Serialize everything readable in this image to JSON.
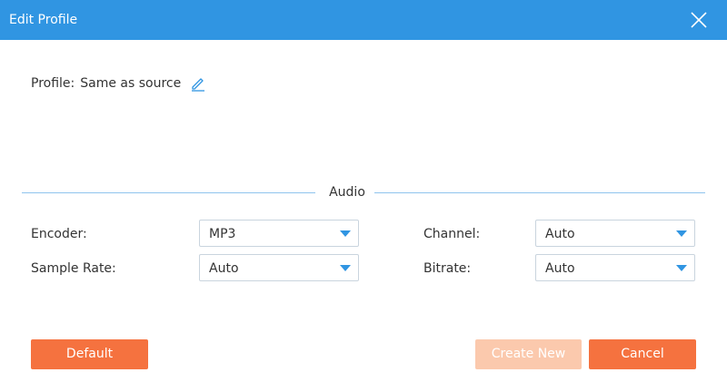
{
  "window": {
    "title": "Edit Profile",
    "close_icon": "close-icon"
  },
  "profile": {
    "label": "Profile:",
    "value": "Same as source",
    "edit_icon": "pencil-icon"
  },
  "audio_section": {
    "title": "Audio",
    "fields": {
      "encoder": {
        "label": "Encoder:",
        "value": "MP3"
      },
      "channel": {
        "label": "Channel:",
        "value": "Auto"
      },
      "sample_rate": {
        "label": "Sample Rate:",
        "value": "Auto"
      },
      "bitrate": {
        "label": "Bitrate:",
        "value": "Auto"
      }
    }
  },
  "buttons": {
    "default": "Default",
    "create_new": "Create New",
    "cancel": "Cancel"
  },
  "colors": {
    "title_bar": "#3095e2",
    "primary_button": "#f5723f",
    "disabled_button": "#fbc9ad",
    "accent": "#3095e2"
  }
}
